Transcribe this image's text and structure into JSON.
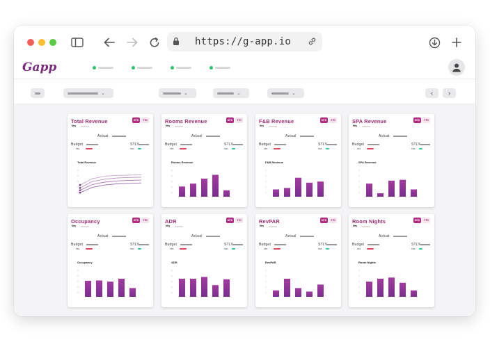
{
  "browser": {
    "url": "https://g-app.io"
  },
  "app": {
    "logo": "Gapp"
  },
  "colors": {
    "brand": "#a0266e",
    "bar_top": "#a23aa0",
    "bar_bottom": "#7a2e8f",
    "status_green": "#2fc26b",
    "budget_red": "#e0425c",
    "stly_green": "#32c48d"
  },
  "cards": [
    {
      "title": "Total Revenue",
      "sub": "Mey",
      "mtd": "MTD",
      "ytd": "YTD",
      "actual": "Actual",
      "budget": "Budget",
      "stly": "STLY",
      "budget_tag": "KBF",
      "stly_tag": "KBF",
      "chart_title": "Total Revenue",
      "chart_type": "line",
      "lines": [
        [
          0.4,
          0.62,
          0.7,
          0.73,
          0.74,
          0.75
        ],
        [
          0.3,
          0.52,
          0.6,
          0.64,
          0.66,
          0.67
        ],
        [
          0.22,
          0.42,
          0.5,
          0.54,
          0.56,
          0.57
        ],
        [
          0.14,
          0.32,
          0.4,
          0.44,
          0.46,
          0.47
        ]
      ]
    },
    {
      "title": "Rooms Revenue",
      "sub": "Mey",
      "mtd": "MTD",
      "ytd": "YTD",
      "actual": "Actual",
      "budget": "Budget",
      "stly": "STLY",
      "budget_tag": "KBF",
      "stly_tag": "KBF",
      "chart_title": "Rooms Revenue",
      "chart_type": "bar",
      "values": [
        0.35,
        0.45,
        0.62,
        0.75,
        0.22
      ]
    },
    {
      "title": "F&B Revenue",
      "sub": "Mey",
      "mtd": "MTD",
      "ytd": "YTD",
      "actual": "Actual",
      "budget": "Budget",
      "stly": "STLY",
      "budget_tag": "KBF",
      "stly_tag": "KBF",
      "chart_title": "F&B Revenue",
      "chart_type": "bar",
      "values": [
        0.25,
        0.3,
        0.65,
        0.48,
        0.52
      ]
    },
    {
      "title": "SPA Revenue",
      "sub": "Mey",
      "mtd": "MTD",
      "ytd": "YTD",
      "actual": "Actual",
      "budget": "Budget",
      "stly": "STLY",
      "budget_tag": "KBF",
      "stly_tag": "KBF",
      "chart_title": "SPA Revenue",
      "chart_type": "bar",
      "values": [
        0.45,
        0.12,
        0.55,
        0.58,
        0.25
      ]
    },
    {
      "title": "Occupancy",
      "sub": "Mey",
      "mtd": "MTD",
      "ytd": "YTD",
      "actual": "Actual",
      "budget": "Budget",
      "stly": "STLY",
      "budget_tag": "KBF",
      "stly_tag": "KBF",
      "chart_title": "Occupancy",
      "chart_type": "bar",
      "values": [
        0.55,
        0.56,
        0.52,
        0.62,
        0.3
      ]
    },
    {
      "title": "ADR",
      "sub": "Mey",
      "mtd": "MTD",
      "ytd": "YTD",
      "actual": "Actual",
      "budget": "Budget",
      "stly": "STLY",
      "budget_tag": "KBF",
      "stly_tag": "KBF",
      "chart_title": "ADR",
      "chart_type": "bar",
      "values": [
        0.62,
        0.62,
        0.68,
        0.4,
        0.6
      ]
    },
    {
      "title": "RevPAR",
      "sub": "Mey",
      "mtd": "MTD",
      "ytd": "YTD",
      "actual": "Actual",
      "budget": "Budget",
      "stly": "STLY",
      "budget_tag": "KBF",
      "stly_tag": "KBF",
      "chart_title": "RevPAR",
      "chart_type": "bar",
      "values": [
        0.22,
        0.62,
        0.3,
        0.18,
        0.42
      ]
    },
    {
      "title": "Room Nights",
      "sub": "Mey",
      "mtd": "MTD",
      "ytd": "YTD",
      "actual": "Actual",
      "budget": "Budget",
      "stly": "STLY",
      "budget_tag": "KBF",
      "stly_tag": "KBF",
      "chart_title": "Room Nights",
      "chart_type": "bar",
      "values": [
        0.52,
        0.62,
        0.66,
        0.48,
        0.22
      ]
    }
  ]
}
